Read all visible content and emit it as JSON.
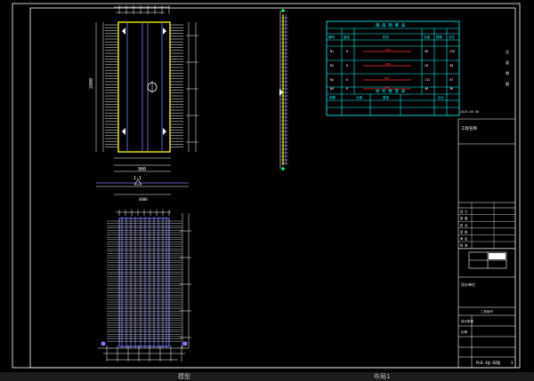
{
  "drawing": {
    "title_block": {
      "row_labels": [
        "设 计",
        "制 图",
        "校 对",
        "审 核",
        "审 定",
        "批 准"
      ],
      "stage_label": "设计阶段",
      "ratio_label": "比例",
      "drawing_name": "PLB-3张-BZ图",
      "drawing_no": "3",
      "company_note": "设计单位",
      "project_label": "工程名称"
    },
    "schedule_table": {
      "title": "钢 筋 明 细 表",
      "headers": [
        "编号",
        "直径",
        "形状",
        "长度",
        "根数",
        "总长"
      ],
      "rows": [
        {
          "id": "N1",
          "dia": "8",
          "len": "4200",
          "num": "56",
          "total": "235"
        },
        {
          "id": "N2",
          "dia": "8",
          "len": "1800",
          "num": "28",
          "total": "50"
        },
        {
          "id": "N3",
          "dia": "6",
          "len": "600",
          "num": "112",
          "total": "67"
        },
        {
          "id": "N4",
          "dia": "6",
          "len": "960",
          "num": "40",
          "total": "38"
        }
      ],
      "summary_title": "材 料 数 量 表",
      "summary_headers": [
        "规格",
        "长度",
        "重量",
        "合计"
      ]
    },
    "dimension_labels": {
      "plan_width": "900",
      "plan_length": "2800",
      "section_label": "1-1"
    },
    "colors": {
      "outline": "#ffffff",
      "table": "#00ffff",
      "slab_edge": "#ffff00",
      "rebar": "#7b7bff",
      "center": "#ff3030",
      "dim": "#00ff66"
    }
  },
  "statusbar": {
    "items": [
      "模型",
      "布局1"
    ]
  }
}
